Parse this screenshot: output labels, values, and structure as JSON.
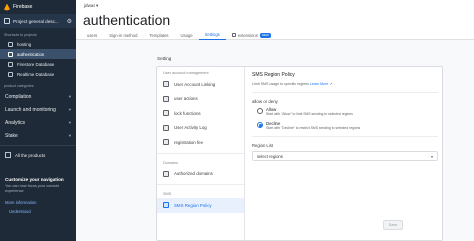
{
  "app": {
    "name": "Firebase"
  },
  "sidebar": {
    "project": "Project general desc...",
    "section_label": "Shortcuts to projects",
    "shortcuts": [
      {
        "label": "hosting",
        "icon": "hosting-icon"
      },
      {
        "label": "authentication",
        "icon": "users-icon",
        "active": true
      },
      {
        "label": "Firestore Database",
        "icon": "database-icon"
      },
      {
        "label": "Realtime Database",
        "icon": "database-icon"
      }
    ],
    "categories_label": "product categories",
    "groups": [
      {
        "label": "Compilation"
      },
      {
        "label": "Launch and monitoring"
      },
      {
        "label": "Analytics"
      },
      {
        "label": "Stake"
      }
    ],
    "all_products": "All the products",
    "customize": {
      "title": "Customize your navigation",
      "description": "You can now focus your console experience",
      "more_info": "More information",
      "understood": "Understood"
    }
  },
  "header": {
    "project_select": "jdwat ▾",
    "title": "authentication",
    "tabs": [
      {
        "label": "users"
      },
      {
        "label": "Sign-in method"
      },
      {
        "label": "Templates"
      },
      {
        "label": "Usage"
      },
      {
        "label": "Settings",
        "active": true
      },
      {
        "label": "extensions",
        "badge": "NEW"
      }
    ]
  },
  "settings": {
    "label": "Setting",
    "nav": {
      "group1_label": "User account management",
      "items1": [
        {
          "label": "User Account Linking"
        },
        {
          "label": "user actions"
        },
        {
          "label": "lock functions"
        },
        {
          "label": "User Activity Log"
        },
        {
          "label": "registration fee"
        }
      ],
      "group2_label": "Domains",
      "items2": [
        {
          "label": "Authorized domains"
        }
      ],
      "group3_label": "SMS",
      "items3": [
        {
          "label": "SMS Region Policy",
          "active": true
        }
      ]
    },
    "panel": {
      "title": "SMS Region Policy",
      "subtitle": "Limit SMS usage to specific regions",
      "learn_more": "Learn More",
      "question": "allow or deny",
      "options": [
        {
          "title": "Allow",
          "desc": "Start with \"Allow\" to limit SMS sending to selected regions",
          "selected": false
        },
        {
          "title": "Decline",
          "desc": "Start with \"Decline\" to restrict SMS sending to selected regions",
          "selected": true
        }
      ],
      "region_list_label": "Region List",
      "region_select": "select regions",
      "save": "Save"
    }
  }
}
